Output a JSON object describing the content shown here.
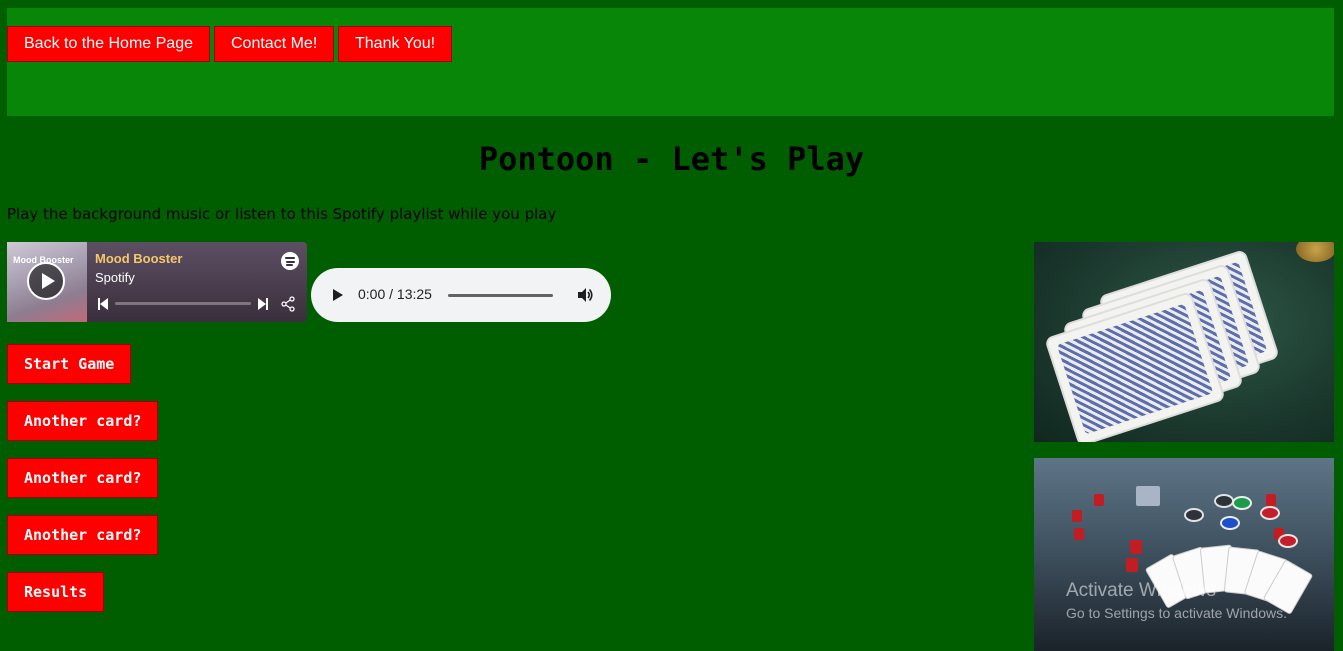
{
  "nav": {
    "home_label": "Back to the Home Page",
    "contact_label": "Contact Me!",
    "thanks_label": "Thank You!"
  },
  "page": {
    "title": "Pontoon - Let's Play",
    "subtitle": "Play the background music or listen to this Spotify playlist while you play"
  },
  "spotify": {
    "cover_text": "Mood Booster",
    "playlist_title": "Mood Booster",
    "artist": "Spotify"
  },
  "audio": {
    "time": "0:00 / 13:25"
  },
  "game": {
    "start_label": "Start Game",
    "another_card_1": "Another card?",
    "another_card_2": "Another card?",
    "another_card_3": "Another card?",
    "results_label": "Results"
  },
  "watermark": {
    "line1": "Activate Windows",
    "line2": "Go to Settings to activate Windows."
  },
  "colors": {
    "page_bg": "#005e00",
    "header_bg": "#078607",
    "button_bg": "#ff0000"
  }
}
